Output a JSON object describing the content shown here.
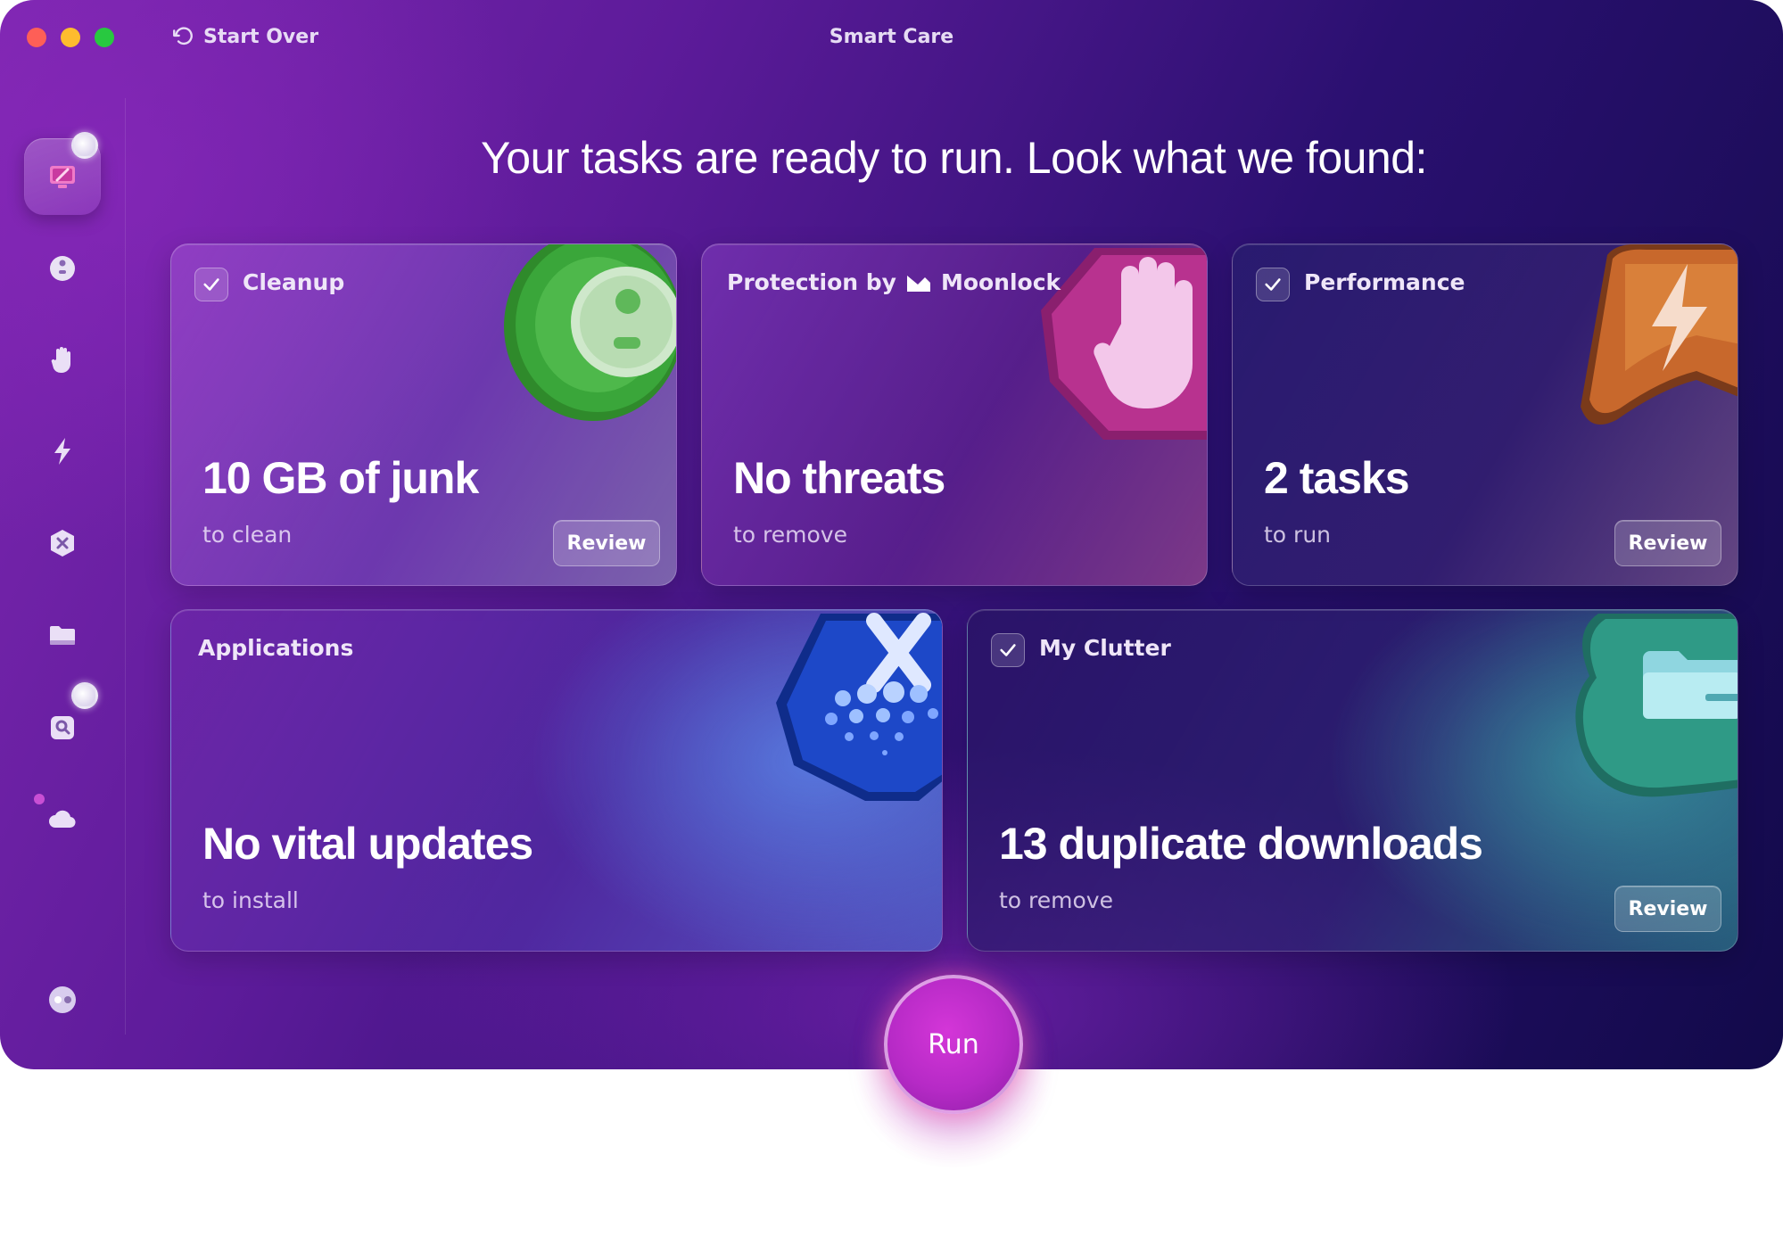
{
  "window": {
    "title": "Smart Care",
    "start_over_label": "Start Over"
  },
  "headline": "Your tasks are ready to run. Look what we found:",
  "sidebar": {
    "items": [
      {
        "icon": "smart-care-icon",
        "active": true,
        "badge": true
      },
      {
        "icon": "cleanup-icon"
      },
      {
        "icon": "protection-hand-icon"
      },
      {
        "icon": "performance-bolt-icon"
      },
      {
        "icon": "applications-icon"
      },
      {
        "icon": "my-clutter-folder-icon"
      },
      {
        "icon": "space-lens-icon",
        "badge": true
      },
      {
        "icon": "cloud-icon",
        "dot": true
      },
      {
        "icon": "assistant-icon"
      }
    ]
  },
  "cards": {
    "cleanup": {
      "label": "Cleanup",
      "checked": true,
      "value": "10 GB of junk",
      "sub": "to clean",
      "review": "Review"
    },
    "protection": {
      "label_prefix": "Protection by",
      "brand": "Moonlock",
      "value": "No threats",
      "sub": "to remove"
    },
    "performance": {
      "label": "Performance",
      "checked": true,
      "value": "2 tasks",
      "sub": "to run",
      "review": "Review"
    },
    "applications": {
      "label": "Applications",
      "value": "No vital updates",
      "sub": "to install"
    },
    "clutter": {
      "label": "My Clutter",
      "checked": true,
      "value": "13 duplicate downloads",
      "sub": "to remove",
      "review": "Review"
    }
  },
  "run_label": "Run",
  "colors": {
    "accent_run": "#c42fcf",
    "traffic_red": "#fe5f57",
    "traffic_yellow": "#febc2e",
    "traffic_green": "#28c840"
  }
}
